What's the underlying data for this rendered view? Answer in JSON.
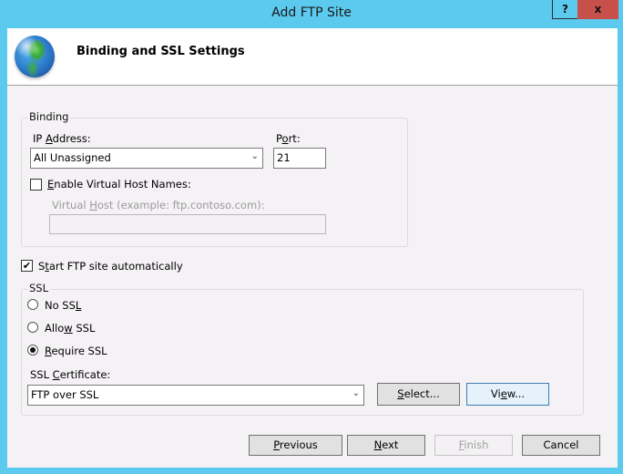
{
  "window": {
    "title": "Add FTP Site",
    "help_label": "?",
    "close_label": "x"
  },
  "header": {
    "icon": "globe-icon",
    "title": "Binding and SSL Settings"
  },
  "binding": {
    "group_label": "Binding",
    "ip_label_pre": "IP ",
    "ip_label_key": "A",
    "ip_label_post": "ddress:",
    "ip_value": "All Unassigned",
    "port_label_pre": "P",
    "port_label_key": "o",
    "port_label_post": "rt:",
    "port_value": "21",
    "virtual_host_checkbox_key": "E",
    "virtual_host_checkbox_rest": "nable Virtual Host Names:",
    "virtual_host_checked": false,
    "virtual_host_label_pre": "Virtual ",
    "virtual_host_label_key": "H",
    "virtual_host_label_post": "ost (example: ftp.contoso.com):",
    "virtual_host_value": ""
  },
  "start_auto": {
    "label_pre": "S",
    "label_key": "t",
    "label_post": "art FTP site automatically",
    "checked": true,
    "check_glyph": "✔"
  },
  "ssl": {
    "group_label": "SSL",
    "options": [
      {
        "pre": "No SS",
        "key": "L",
        "post": "",
        "selected": false
      },
      {
        "pre": "Allo",
        "key": "w",
        "post": " SSL",
        "selected": false
      },
      {
        "pre": "",
        "key": "R",
        "post": "equire SSL",
        "selected": true
      }
    ],
    "cert_label_pre": "SSL ",
    "cert_label_key": "C",
    "cert_label_post": "ertificate:",
    "cert_value": "FTP over SSL",
    "select_key": "S",
    "select_rest": "elect...",
    "view_pre": "Vi",
    "view_key": "e",
    "view_post": "w..."
  },
  "footer": {
    "previous_key": "P",
    "previous_rest": "revious",
    "next_key": "N",
    "next_rest": "ext",
    "finish_key": "F",
    "finish_rest": "inish",
    "cancel_label": "Cancel"
  },
  "dropdown_glyph": "⌄"
}
